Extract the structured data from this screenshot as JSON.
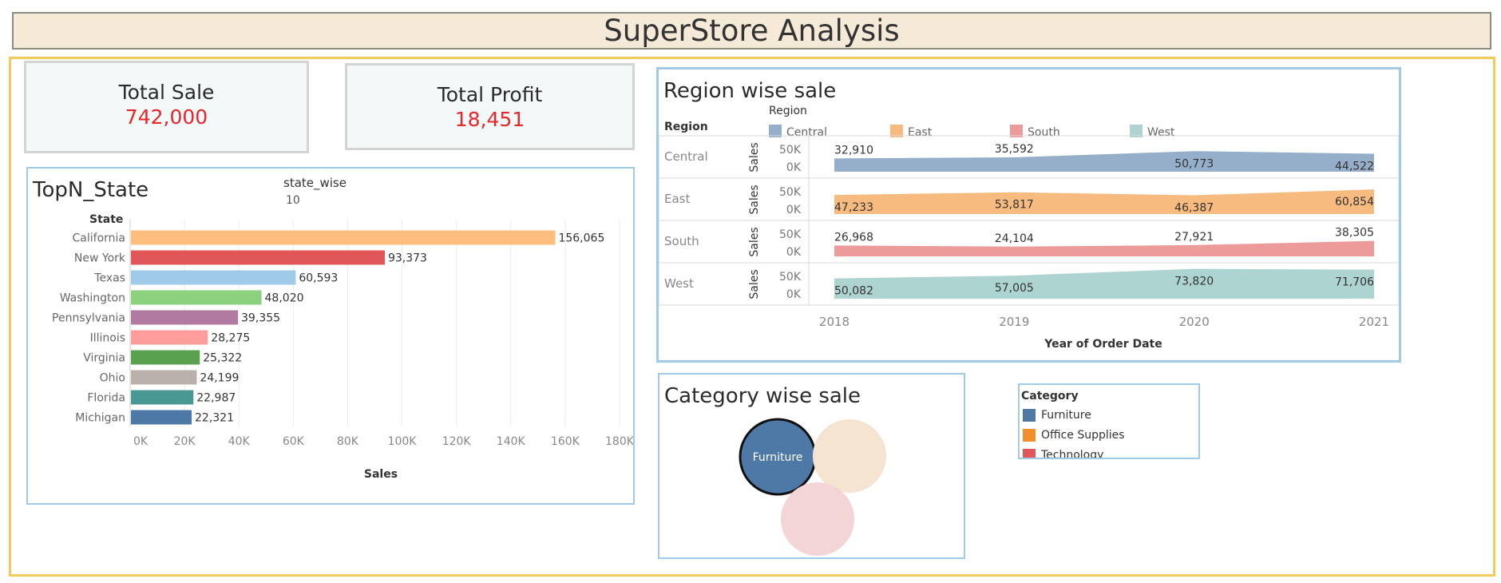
{
  "dashboard_title": "SuperStore Analysis",
  "kpis": {
    "sale": {
      "label": "Total Sale",
      "value": "742,000"
    },
    "profit": {
      "label": "Total Profit",
      "value": "18,451"
    }
  },
  "colors": {
    "kpi_value": "#e8262a",
    "panel_border": "#9fcbe6",
    "outer_border": "#f2cb5c"
  },
  "chart_data": [
    {
      "type": "bar",
      "title": "TopN_State",
      "parameter": {
        "label": "state_wise",
        "value": "10"
      },
      "ylabel": "State",
      "xlabel": "Sales",
      "categories": [
        "California",
        "New York",
        "Texas",
        "Washington",
        "Pennsylvania",
        "Illinois",
        "Virginia",
        "Ohio",
        "Florida",
        "Michigan"
      ],
      "values": [
        156065,
        93373,
        60593,
        48020,
        39355,
        28275,
        25322,
        24199,
        22987,
        22321
      ],
      "value_labels": [
        "156,065",
        "93,373",
        "60,593",
        "48,020",
        "39,355",
        "28,275",
        "25,322",
        "24,199",
        "22,987",
        "22,321"
      ],
      "colors": [
        "#ffbe7d",
        "#e15759",
        "#a0cbe8",
        "#8cd17d",
        "#b07aa1",
        "#ff9d9a",
        "#59a14f",
        "#bab0ac",
        "#499894",
        "#4e79a7"
      ],
      "xlim": [
        0,
        185000
      ],
      "xticks": [
        0,
        20000,
        40000,
        60000,
        80000,
        100000,
        120000,
        140000,
        160000,
        180000
      ],
      "xtick_labels": [
        "0K",
        "20K",
        "40K",
        "60K",
        "80K",
        "100K",
        "120K",
        "140K",
        "160K",
        "180K"
      ],
      "grid": true
    },
    {
      "type": "area",
      "title": "Region wise sale",
      "legend_title": "Region",
      "row_header": "Region",
      "xlabel": "Year of Order Date",
      "ylabel": "Sales",
      "x": [
        "2018",
        "2019",
        "2020",
        "2021"
      ],
      "ylim": [
        0,
        60000
      ],
      "ytick_labels": [
        "50K",
        "0K"
      ],
      "series": [
        {
          "name": "Central",
          "color": "#4e79a7",
          "values": [
            32910,
            35592,
            50773,
            44522
          ],
          "labels": [
            "32,910",
            "35,592",
            "50,773",
            "44,522"
          ]
        },
        {
          "name": "East",
          "color": "#f28e2b",
          "values": [
            47233,
            53817,
            46387,
            60854
          ],
          "labels": [
            "47,233",
            "53,817",
            "46,387",
            "60,854"
          ]
        },
        {
          "name": "South",
          "color": "#e15759",
          "values": [
            26968,
            24104,
            27921,
            38305
          ],
          "labels": [
            "26,968",
            "24,104",
            "27,921",
            "38,305"
          ]
        },
        {
          "name": "West",
          "color": "#76b7b2",
          "values": [
            50082,
            57005,
            73820,
            71706
          ],
          "labels": [
            "50,082",
            "57,005",
            "73,820",
            "71,706"
          ]
        }
      ]
    },
    {
      "type": "bubble",
      "title": "Category wise sale",
      "legend_title": "Category",
      "categories": [
        "Furniture",
        "Office Supplies",
        "Technology"
      ],
      "colors": [
        "#4e79a7",
        "#f28e2b",
        "#e15759"
      ],
      "highlighted": "Furniture"
    }
  ]
}
